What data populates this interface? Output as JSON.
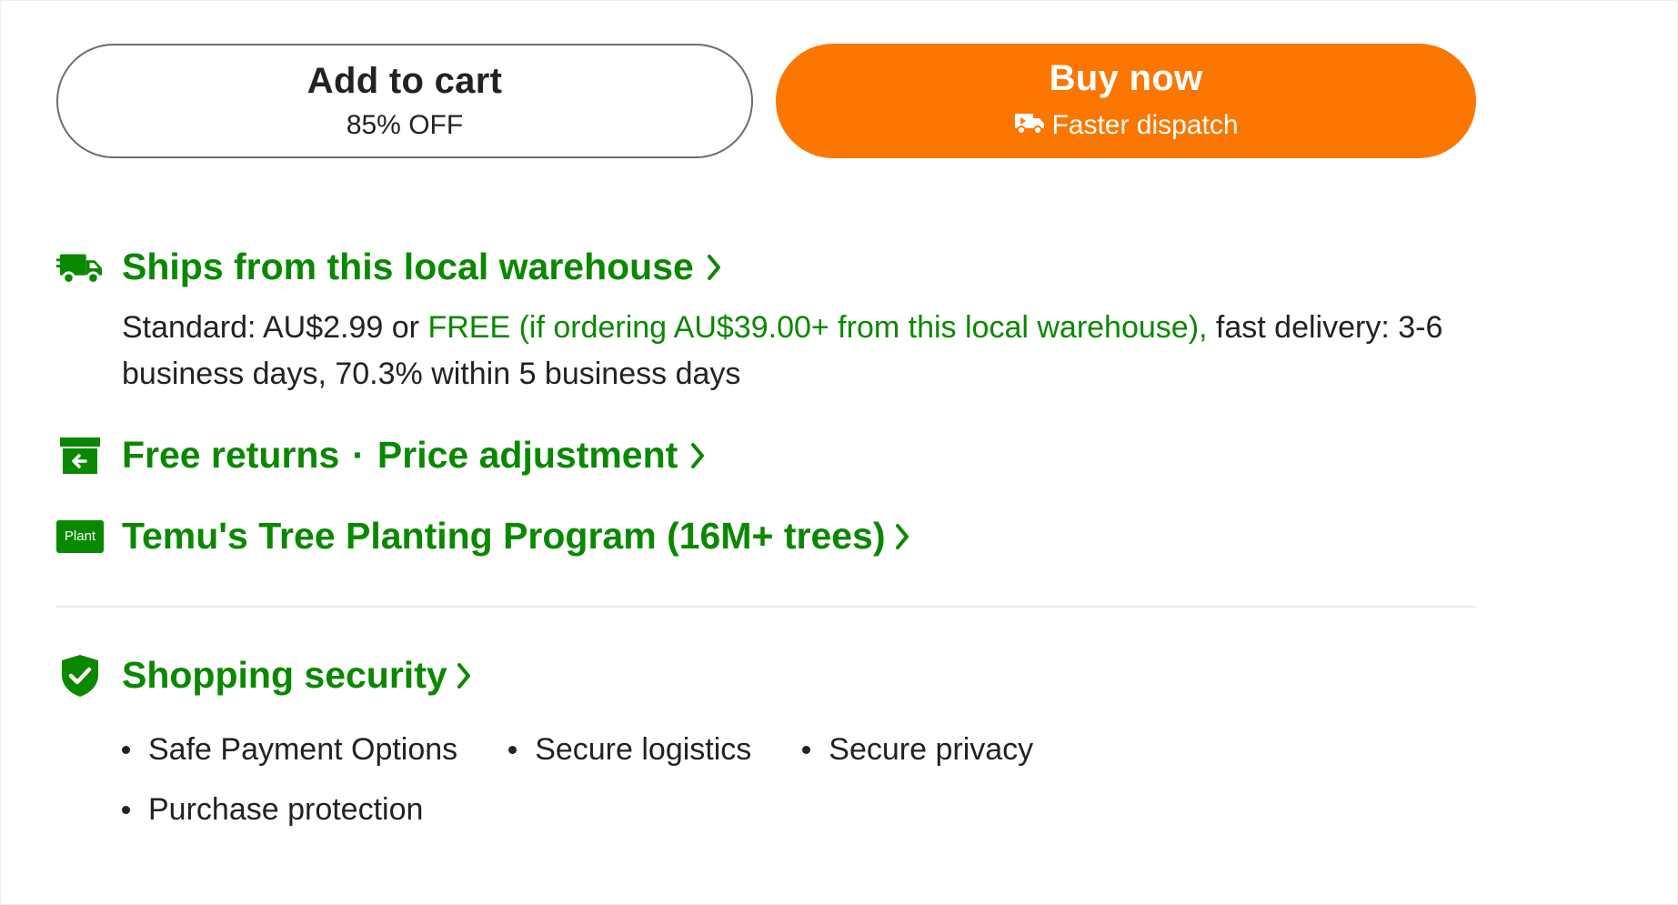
{
  "actions": {
    "add_to_cart": {
      "label": "Add to cart",
      "sub": "85% OFF"
    },
    "buy_now": {
      "label": "Buy now",
      "sub": "Faster dispatch",
      "sub_icon": "fast-truck-icon"
    }
  },
  "shipping": {
    "icon": "delivery-truck-icon",
    "title": "Ships from this local warehouse",
    "standard_prefix": "Standard: AU$2.99 or ",
    "free_text": "FREE (if ordering AU$39.00+ from this local warehouse),",
    "delivery_text": " fast delivery: 3-6 business days, 70.3% within 5 business days"
  },
  "returns": {
    "icon": "return-box-icon",
    "title_part1": "Free returns",
    "separator": "·",
    "title_part2": "Price adjustment"
  },
  "tree_program": {
    "icon_label": "Plant",
    "title": "Temu's Tree Planting Program (16M+ trees)"
  },
  "security": {
    "icon": "shield-check-icon",
    "title": "Shopping security",
    "items": [
      "Safe Payment Options",
      "Secure logistics",
      "Secure privacy",
      "Purchase protection"
    ]
  },
  "colors": {
    "accent_green": "#0a8800",
    "brand_orange": "#fb7701",
    "text": "#222222"
  }
}
